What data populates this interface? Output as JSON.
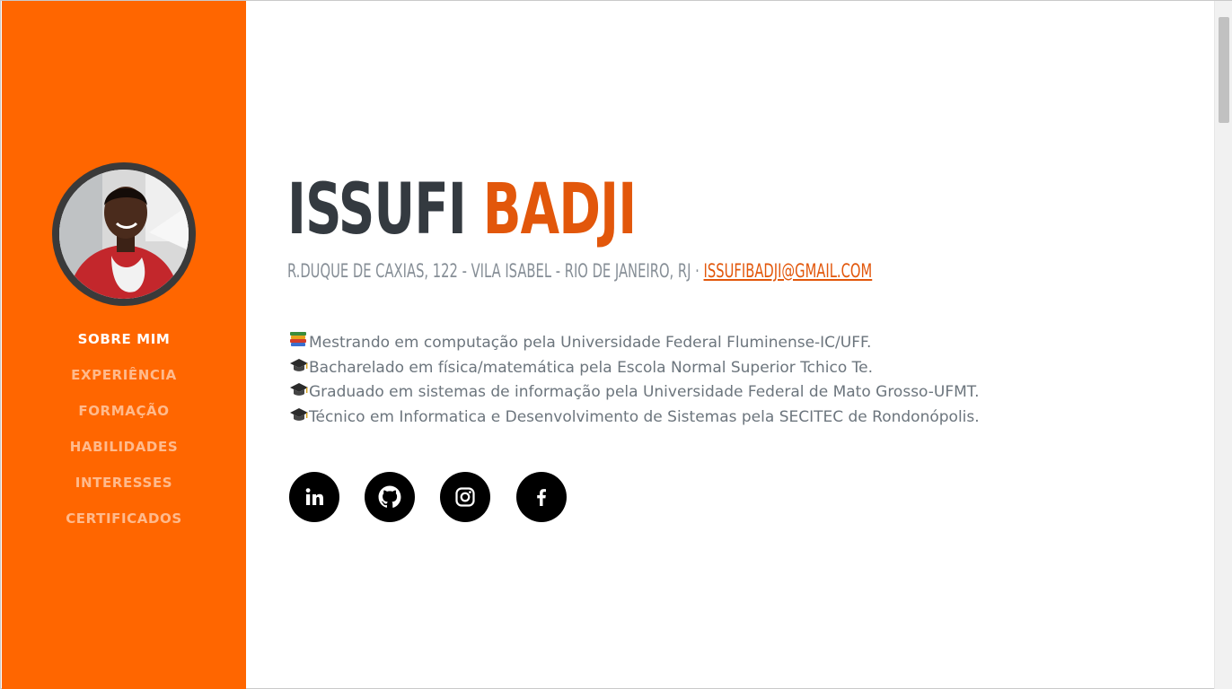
{
  "sidebar": {
    "avatar_alt": "Issufi Badji",
    "nav": [
      {
        "label": "SOBRE MIM",
        "active": true
      },
      {
        "label": "EXPERIÊNCIA",
        "active": false
      },
      {
        "label": "FORMAÇÃO",
        "active": false
      },
      {
        "label": "HABILIDADES",
        "active": false
      },
      {
        "label": "INTERESSES",
        "active": false
      },
      {
        "label": "CERTIFICADOS",
        "active": false
      }
    ],
    "color": "#ff6600"
  },
  "header": {
    "first_name": "ISSUFI",
    "last_name": "BADJI",
    "address": "R.DUQUE DE CAXIAS, 122 - VILA ISABEL - RIO DE JANEIRO, RJ · ",
    "email": "ISSUFIBADJI@GMAIL.COM"
  },
  "about": {
    "items": [
      {
        "icon": "books-icon",
        "text": "Mestrando em computação pela Universidade Federal Fluminense-IC/UFF."
      },
      {
        "icon": "graduation-cap-icon",
        "text": "Bacharelado em física/matemática pela Escola Normal Superior Tchico Te."
      },
      {
        "icon": "graduation-cap-icon",
        "text": "Graduado em sistemas de informação pela Universidade Federal de Mato Grosso-UFMT."
      },
      {
        "icon": "graduation-cap-icon",
        "text": "Técnico em Informatica e Desenvolvimento de Sistemas pela SECITEC de Rondonópolis."
      }
    ]
  },
  "socials": [
    {
      "name": "linkedin-icon"
    },
    {
      "name": "github-icon"
    },
    {
      "name": "instagram-icon"
    },
    {
      "name": "facebook-icon"
    }
  ],
  "colors": {
    "accent": "#e2570b",
    "heading": "#343a40",
    "muted": "#868e96",
    "body_text": "#6c757d"
  }
}
